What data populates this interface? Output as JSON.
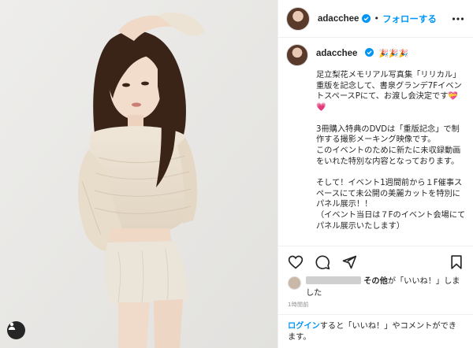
{
  "header": {
    "username": "adacchee",
    "separator": "•",
    "follow_label": "フォローする"
  },
  "caption": {
    "username": "adacchee",
    "sparkles": "🎉🎉🎉",
    "text": "足立梨花メモリアル写真集「リリカル」重版を記念して、書泉グランデ7FイベントスペースPにて、お渡し会決定です💝💗\n\n3冊購入特典のDVDは「重版記念」で制作する撮影メーキング映像です。\nこのイベントのために新たに未収録動画をいれた特別な内容となっております。\n\nそして！イベント1週間前から１F催事スペースにて未公開の美麗カットを特別にパネル展示！！\n（イベント当日は７Fのイベント会場にてパネル展示いたします）"
  },
  "likes": {
    "others_label": "その他",
    "suffix": "が「いいね！」しました"
  },
  "timestamp": "1時間前",
  "login_prompt": {
    "link_label": "ログイン",
    "text": "すると「いいね！」やコメントができます。"
  },
  "colors": {
    "link": "#0095f6",
    "text": "#262626",
    "border": "#efefef"
  },
  "icons": [
    "verified-badge-icon",
    "more-options-icon",
    "heart-icon",
    "comment-icon",
    "share-icon",
    "bookmark-icon",
    "user-tag-icon"
  ]
}
